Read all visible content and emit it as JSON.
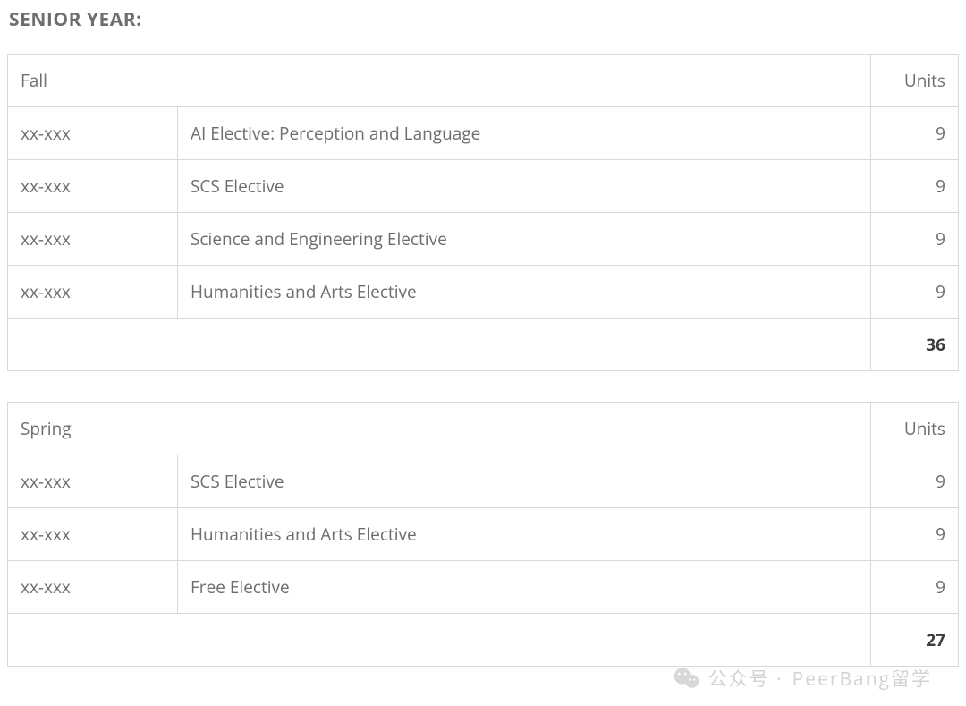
{
  "title": "SENIOR YEAR:",
  "tables": [
    {
      "term_label": "Fall",
      "units_label": "Units",
      "rows": [
        {
          "code": "xx-xxx",
          "name": "AI Elective: Perception and Language",
          "units": "9"
        },
        {
          "code": "xx-xxx",
          "name": "SCS Elective",
          "units": "9"
        },
        {
          "code": "xx-xxx",
          "name": "Science and Engineering Elective",
          "units": "9"
        },
        {
          "code": "xx-xxx",
          "name": "Humanities and Arts Elective",
          "units": "9"
        }
      ],
      "total": "36"
    },
    {
      "term_label": "Spring",
      "units_label": "Units",
      "rows": [
        {
          "code": "xx-xxx",
          "name": "SCS Elective",
          "units": "9"
        },
        {
          "code": "xx-xxx",
          "name": "Humanities and Arts Elective",
          "units": "9"
        },
        {
          "code": "xx-xxx",
          "name": "Free Elective",
          "units": "9"
        }
      ],
      "total": "27"
    }
  ],
  "watermark": {
    "label_prefix": "公众号 ·",
    "label_name": "PeerBang留学"
  }
}
